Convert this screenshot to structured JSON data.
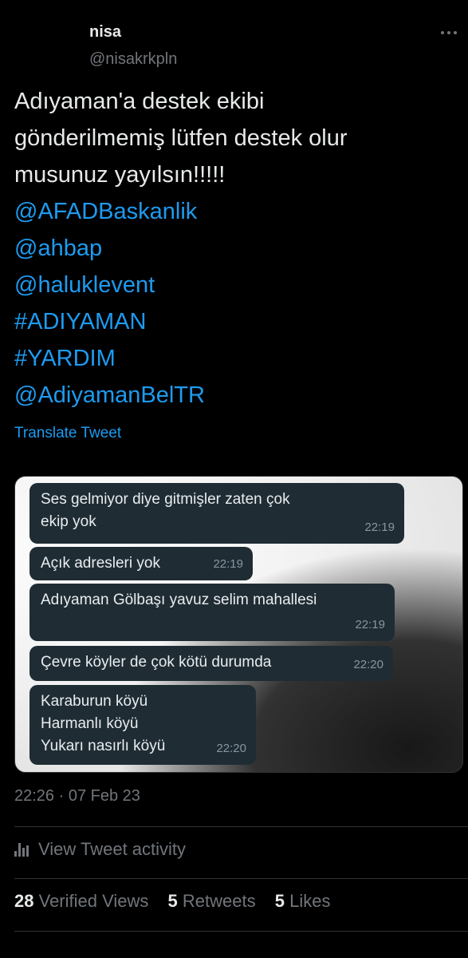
{
  "tweet": {
    "author_name": "nisa",
    "author_handle": "@nisakrkpln",
    "text_lines": [
      "Adıyaman'a destek ekibi",
      "gönderilmemiş lütfen destek olur",
      "musunuz yayılsın!!!!!"
    ],
    "mentions": [
      "@AFADBaskanlik",
      "@ahbap",
      "@haluklevent",
      "#ADIYAMAN",
      "#YARDIM",
      "@AdiyamanBelTR"
    ],
    "translate_label": "Translate Tweet",
    "timestamp": "22:26 · 07 Feb 23"
  },
  "media": {
    "messages": [
      {
        "lines": [
          "Ses gelmiyor diye gitmişler zaten çok",
          "ekip yok"
        ],
        "time": "22:19"
      },
      {
        "lines": [
          "Açık adresleri yok"
        ],
        "time": "22:19"
      },
      {
        "lines": [
          "Adıyaman Gölbaşı yavuz selim mahallesi"
        ],
        "time": "22:19"
      },
      {
        "lines": [
          "Çevre köyler de çok kötü durumda"
        ],
        "time": "22:20"
      },
      {
        "lines": [
          "Karaburun köyü",
          "Harmanlı köyü",
          "Yukarı nasırlı köyü"
        ],
        "time": "22:20"
      }
    ]
  },
  "activity": {
    "label": "View Tweet activity",
    "icon": "bar-chart-icon"
  },
  "stats": {
    "views_count": "28",
    "views_label": "Verified Views",
    "retweets_count": "5",
    "retweets_label": "Retweets",
    "likes_count": "5",
    "likes_label": "Likes"
  },
  "colors": {
    "link": "#1d9bf0",
    "muted": "#71767b",
    "bubble": "#1f2c34"
  }
}
